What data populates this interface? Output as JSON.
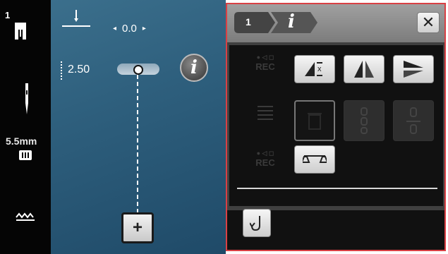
{
  "left_bar": {
    "presser_foot_number": "1",
    "stitch_width": "5.5mm",
    "icons": [
      "presser-foot-icon",
      "needle-icon",
      "stitch-plate-icon",
      "stitch-pattern-icon"
    ]
  },
  "stitch_area": {
    "needle_position": "0.0",
    "stitch_length": "2.50",
    "arrow_left": "◂",
    "arrow_right": "▸",
    "info_label": "i",
    "add_label": "+"
  },
  "panel": {
    "breadcrumb": [
      "1",
      "i"
    ],
    "close_label": "✕",
    "rec_label": "REC",
    "rec_sub": "● ◁ ◻",
    "buttons": [
      {
        "name": "pattern-end-icon",
        "state": "enabled"
      },
      {
        "name": "mirror-horizontal-icon",
        "state": "enabled"
      },
      {
        "name": "mirror-vertical-icon",
        "state": "enabled"
      },
      {
        "name": "delete-icon",
        "state": "selected"
      },
      {
        "name": "repeat-icon",
        "state": "disabled"
      },
      {
        "name": "long-stitch-icon",
        "state": "disabled"
      },
      {
        "name": "balance-icon",
        "state": "enabled"
      }
    ],
    "back_icon": "return-arrow-icon"
  },
  "colors": {
    "panel_border": "#d94044",
    "stitch_bg": "#2e5f7d"
  }
}
